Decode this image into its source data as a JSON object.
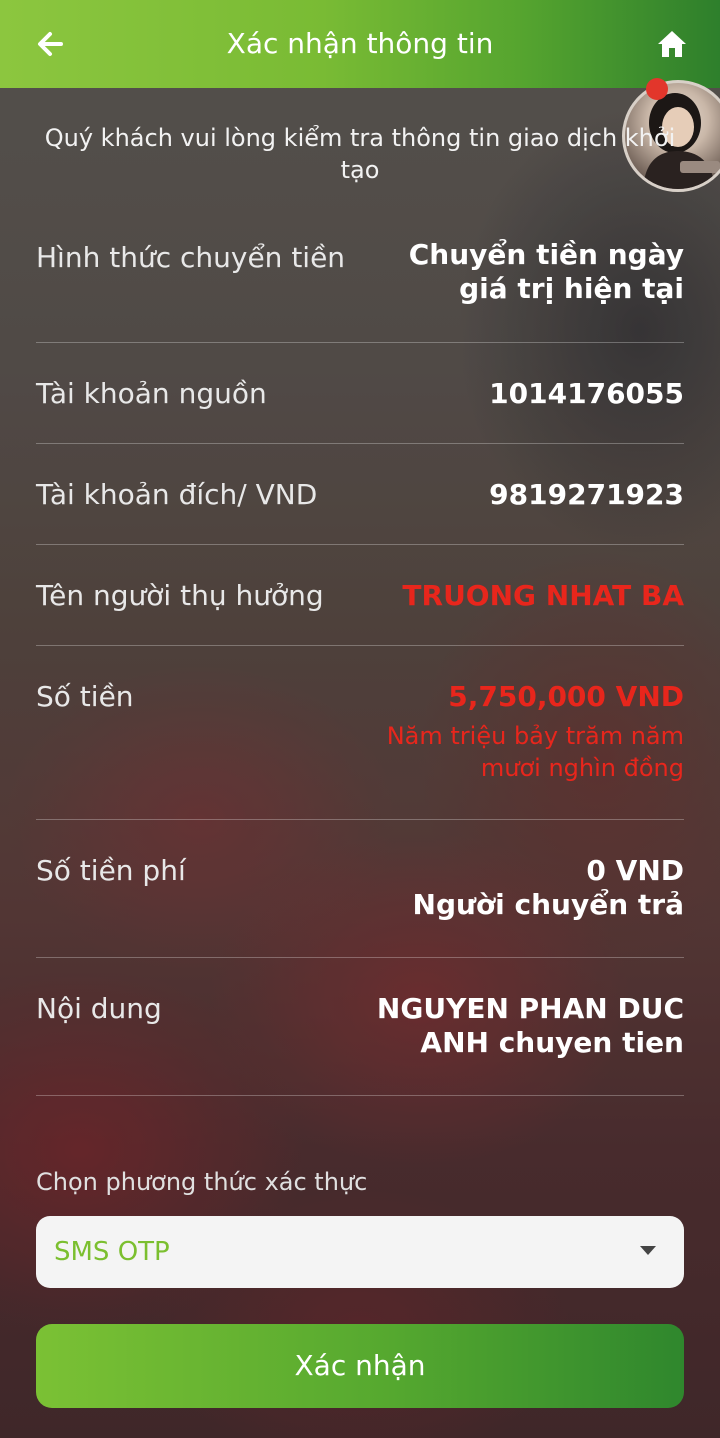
{
  "header": {
    "title": "Xác nhận thông tin",
    "back_icon": "arrow-left-icon",
    "home_icon": "home-icon"
  },
  "intro": "Quý khách vui lòng kiểm tra thông tin giao dịch khởi tạo",
  "rows": [
    {
      "label": "Hình thức chuyển tiền",
      "value": "Chuyển tiền ngày giá trị hiện tại"
    },
    {
      "label": "Tài khoản nguồn",
      "value": "1014176055"
    },
    {
      "label": "Tài khoản đích/ VND",
      "value": "9819271923"
    },
    {
      "label": "Tên người thụ hưởng",
      "value": "TRUONG NHAT BA"
    },
    {
      "label": "Số tiền",
      "value": "5,750,000 VND",
      "sub": "Năm triệu bảy trăm năm mươi nghìn đồng"
    },
    {
      "label": "Số tiền phí",
      "value": "0 VND",
      "sub": "Người chuyển trả"
    },
    {
      "label": "Nội dung",
      "value": "NGUYEN PHAN DUC ANH chuyen tien"
    }
  ],
  "auth": {
    "label": "Chọn phương thức xác thực",
    "selected": "SMS OTP"
  },
  "confirm_label": "Xác nhận",
  "colors": {
    "brand_green": "#7bbf2f",
    "alert_red": "#e8261c"
  }
}
